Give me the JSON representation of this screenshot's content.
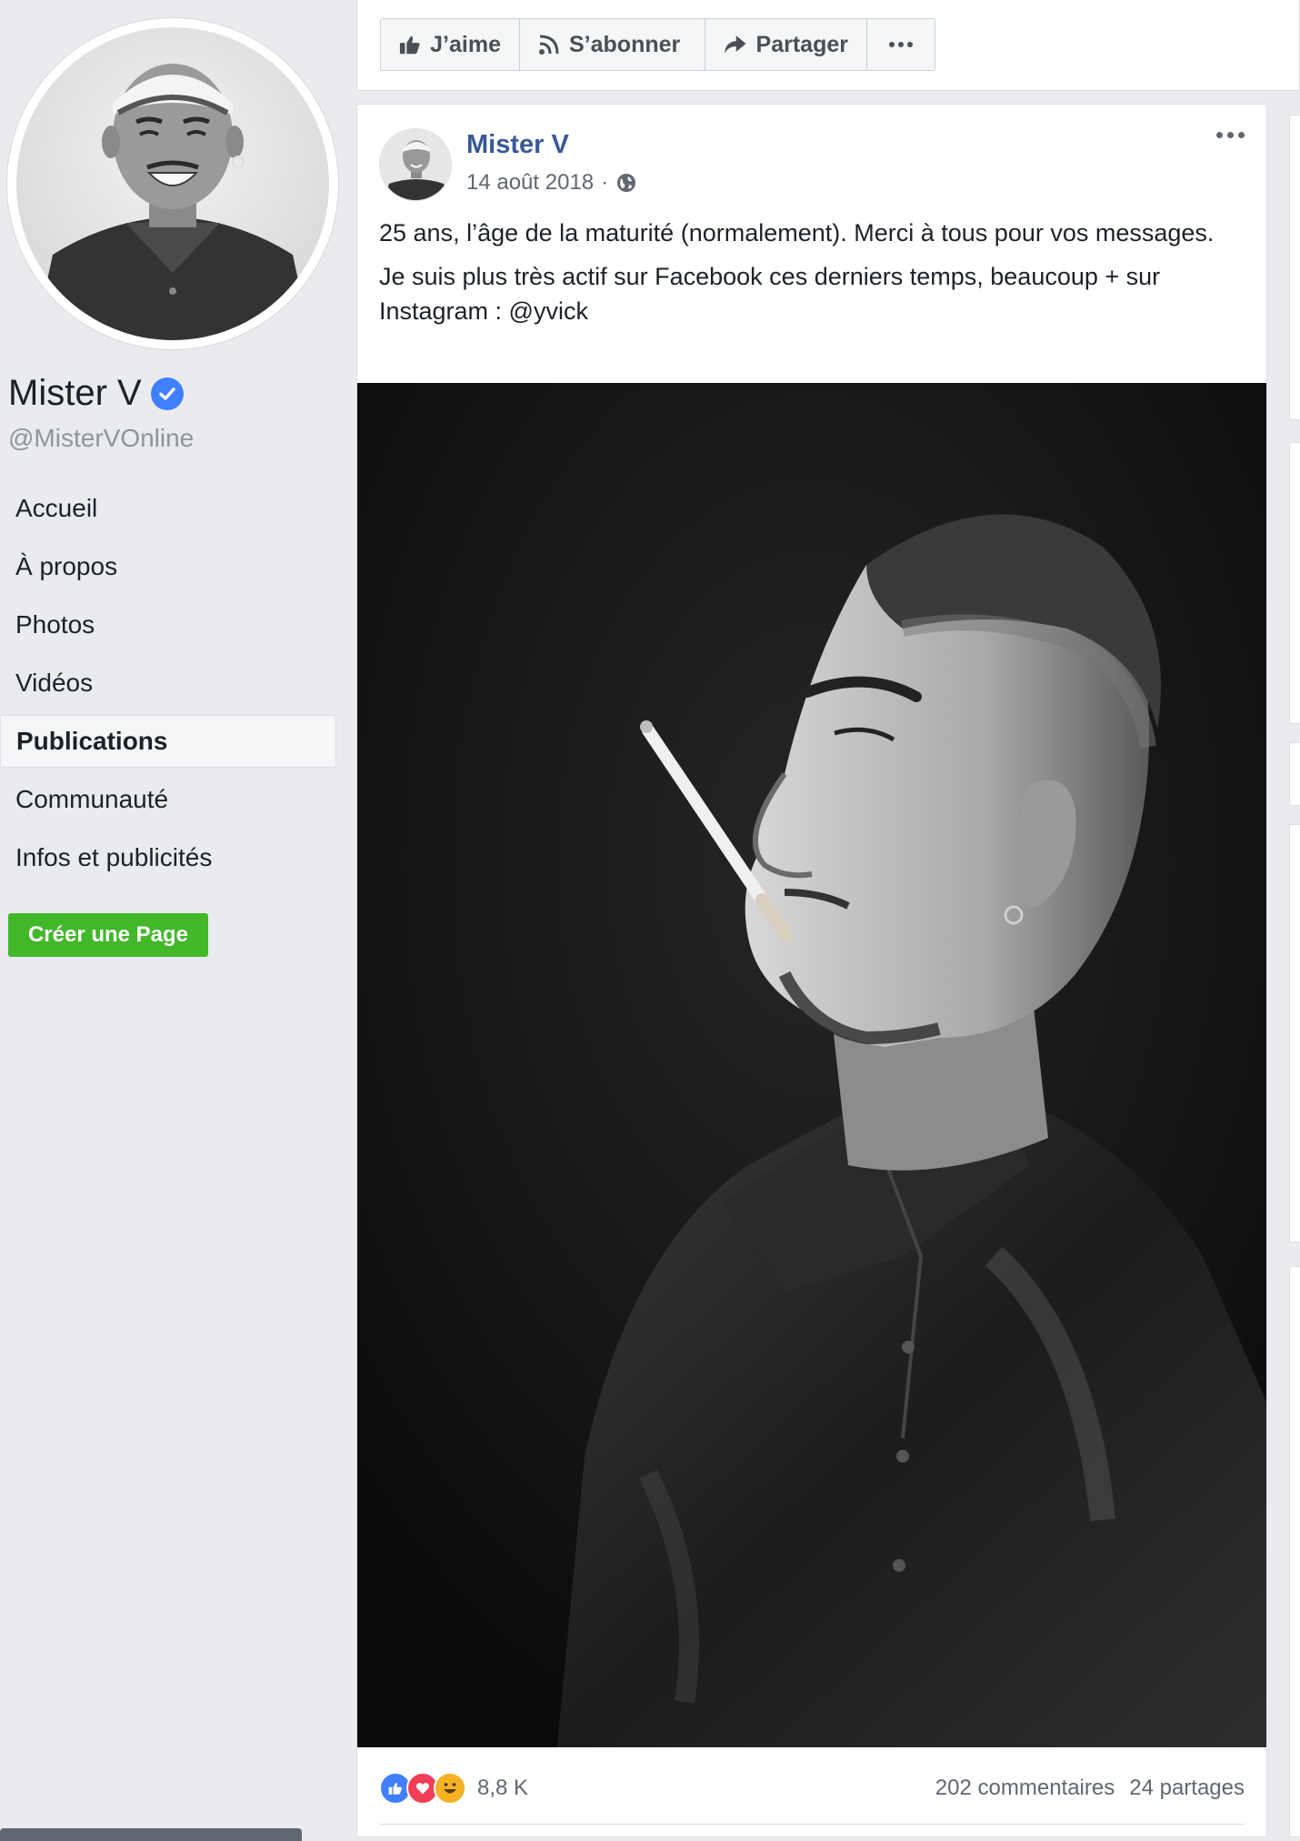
{
  "page": {
    "name": "Mister V",
    "handle": "@MisterVOnline"
  },
  "nav": {
    "items": [
      {
        "label": "Accueil",
        "active": false
      },
      {
        "label": "À propos",
        "active": false
      },
      {
        "label": "Photos",
        "active": false
      },
      {
        "label": "Vidéos",
        "active": false
      },
      {
        "label": "Publications",
        "active": true
      },
      {
        "label": "Communauté",
        "active": false
      },
      {
        "label": "Infos et publicités",
        "active": false
      }
    ],
    "create_page_label": "Créer une Page"
  },
  "actions": {
    "like_label": "J’aime",
    "follow_label": "S’abonner",
    "share_label": "Partager"
  },
  "post": {
    "author": "Mister V",
    "date": "14 août 2018",
    "separator": "·",
    "paragraphs": [
      "25 ans, l’âge de la maturité (normalement). Merci à tous pour vos messages.",
      "Je suis plus très actif sur Facebook ces derniers temps, beaucoup + sur Instagram : @yvick"
    ],
    "reaction_count": "8,8 K",
    "comments": "202 commentaires",
    "shares": "24 partages"
  },
  "colors": {
    "link_blue": "#385898",
    "verified_blue": "#4080ff",
    "create_green": "#42b72a",
    "page_bg": "#e9ebee"
  },
  "icons": [
    "verified-badge-icon",
    "thumbs-up-icon",
    "rss-icon",
    "share-arrow-icon",
    "more-dots-icon",
    "globe-icon",
    "like-reaction-icon",
    "love-reaction-icon",
    "haha-reaction-icon"
  ]
}
